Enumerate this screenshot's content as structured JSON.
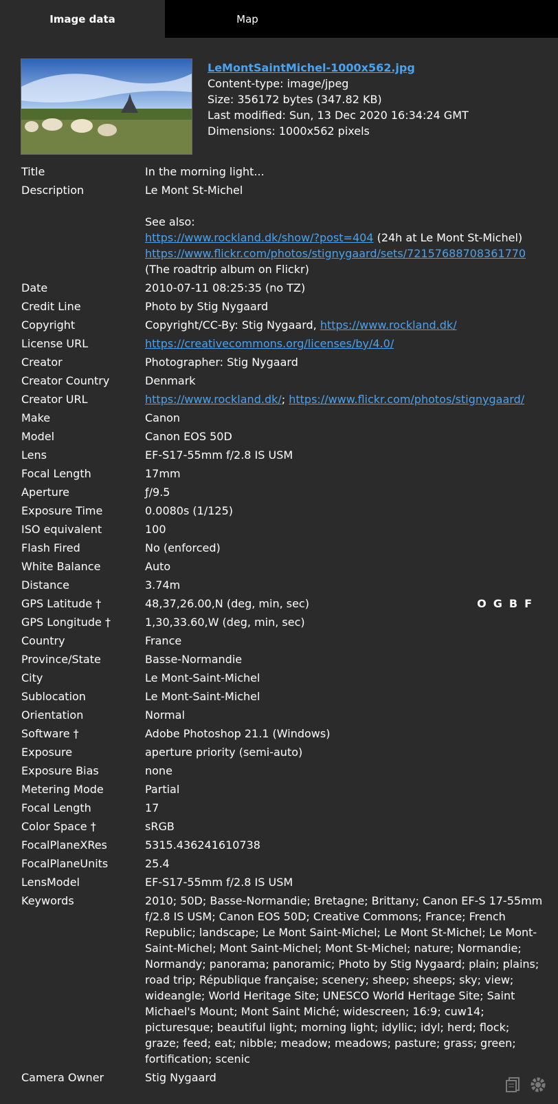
{
  "tabs": [
    {
      "label": "Image data"
    },
    {
      "label": "Map"
    }
  ],
  "file": {
    "name": "LeMontSaintMichel-1000x562.jpg",
    "content_type": "Content-type: image/jpeg",
    "size": "Size: 356172 bytes (347.82 KB)",
    "last_modified": "Last modified: Sun, 13 Dec 2020 16:34:24 GMT",
    "dimensions": "Dimensions: 1000x562 pixels"
  },
  "rows": {
    "title": {
      "label": "Title",
      "value": "In the morning light..."
    },
    "description": {
      "label": "Description",
      "line1": "Le Mont St-Michel",
      "line2": "See also:",
      "link1": "https://www.rockland.dk/show/?post=404",
      "text1": " (24h at Le Mont St-Michel)",
      "link2": "https://www.flickr.com/photos/stignygaard/sets/72157688708361770",
      "text2": " (The roadtrip album on Flickr)"
    },
    "date": {
      "label": "Date",
      "value": "2010-07-11 08:25:35 (no TZ)"
    },
    "credit": {
      "label": "Credit Line",
      "value": "Photo by Stig Nygaard"
    },
    "copyright": {
      "label": "Copyright",
      "value": "Copyright/CC-By: Stig Nygaard, ",
      "link": "https://www.rockland.dk/"
    },
    "license": {
      "label": "License URL",
      "link": "https://creativecommons.org/licenses/by/4.0/"
    },
    "creator": {
      "label": "Creator",
      "value": "Photographer: Stig Nygaard"
    },
    "creator_country": {
      "label": "Creator Country",
      "value": "Denmark"
    },
    "creator_url": {
      "label": "Creator URL",
      "link1": "https://www.rockland.dk/",
      "sep": "; ",
      "link2": "https://www.flickr.com/photos/stignygaard/"
    },
    "make": {
      "label": "Make",
      "value": "Canon"
    },
    "model": {
      "label": "Model",
      "value": "Canon EOS 50D"
    },
    "lens": {
      "label": "Lens",
      "value": "EF-S17-55mm f/2.8 IS USM"
    },
    "focal": {
      "label": "Focal Length",
      "value": "17mm"
    },
    "aperture": {
      "label": "Aperture",
      "value": "ƒ/9.5"
    },
    "exposure_time": {
      "label": "Exposure Time",
      "value": "0.0080s (1/125)"
    },
    "iso": {
      "label": "ISO equivalent",
      "value": "100"
    },
    "flash": {
      "label": "Flash Fired",
      "value": "No (enforced)"
    },
    "wb": {
      "label": "White Balance",
      "value": "Auto"
    },
    "distance": {
      "label": "Distance",
      "value": "3.74m"
    },
    "gps_lat": {
      "label": "GPS Latitude †",
      "value": "48,37,26.00,N (deg, min, sec)",
      "links": "OGBF"
    },
    "gps_lon": {
      "label": "GPS Longitude †",
      "value": "1,30,33.60,W (deg, min, sec)"
    },
    "country": {
      "label": "Country",
      "value": "France"
    },
    "province": {
      "label": "Province/State",
      "value": "Basse-Normandie"
    },
    "city": {
      "label": "City",
      "value": "Le Mont-Saint-Michel"
    },
    "sublocation": {
      "label": "Sublocation",
      "value": "Le Mont-Saint-Michel"
    },
    "orientation": {
      "label": "Orientation",
      "value": "Normal"
    },
    "software": {
      "label": "Software †",
      "value": "Adobe Photoshop 21.1 (Windows)"
    },
    "exposure": {
      "label": "Exposure",
      "value": "aperture priority (semi-auto)"
    },
    "exposure_bias": {
      "label": "Exposure Bias",
      "value": "none"
    },
    "metering": {
      "label": "Metering Mode",
      "value": "Partial"
    },
    "focal2": {
      "label": "Focal Length",
      "value": "17"
    },
    "color_space": {
      "label": "Color Space †",
      "value": "sRGB"
    },
    "fpxres": {
      "label": "FocalPlaneXRes",
      "value": "5315.436241610738"
    },
    "fpunits": {
      "label": "FocalPlaneUnits",
      "value": "25.4"
    },
    "lens_model": {
      "label": "LensModel",
      "value": "EF-S17-55mm f/2.8 IS USM"
    },
    "keywords": {
      "label": "Keywords",
      "value": "2010; 50D; Basse-Normandie; Bretagne; Brittany; Canon EF-S 17-55mm f/2.8 IS USM; Canon EOS 50D; Creative Commons; France; French Republic; landscape; Le Mont Saint-Michel; Le Mont St-Michel; Le Mont-Saint-Michel; Mont Saint-Michel; Mont St-Michel; nature; Normandie; Normandy; panorama; panoramic; Photo by Stig Nygaard; plain; plains; road trip; République française; scenery; sheep; sheeps; sky; view; wideangle; World Heritage Site; UNESCO World Heritage Site; Saint Michael's Mount; Mont Saint Miché; widescreen; 16:9; cuw14; picturesque; beautiful light; morning light; idyllic; idyl; herd; flock; graze; feed; eat; nibble; meadow; meadows; pasture; grass; green; fortification; scenic"
    },
    "owner": {
      "label": "Camera Owner",
      "value": "Stig Nygaard"
    }
  },
  "icons": {
    "copy": "copy-icon",
    "settings": "gear-icon"
  }
}
